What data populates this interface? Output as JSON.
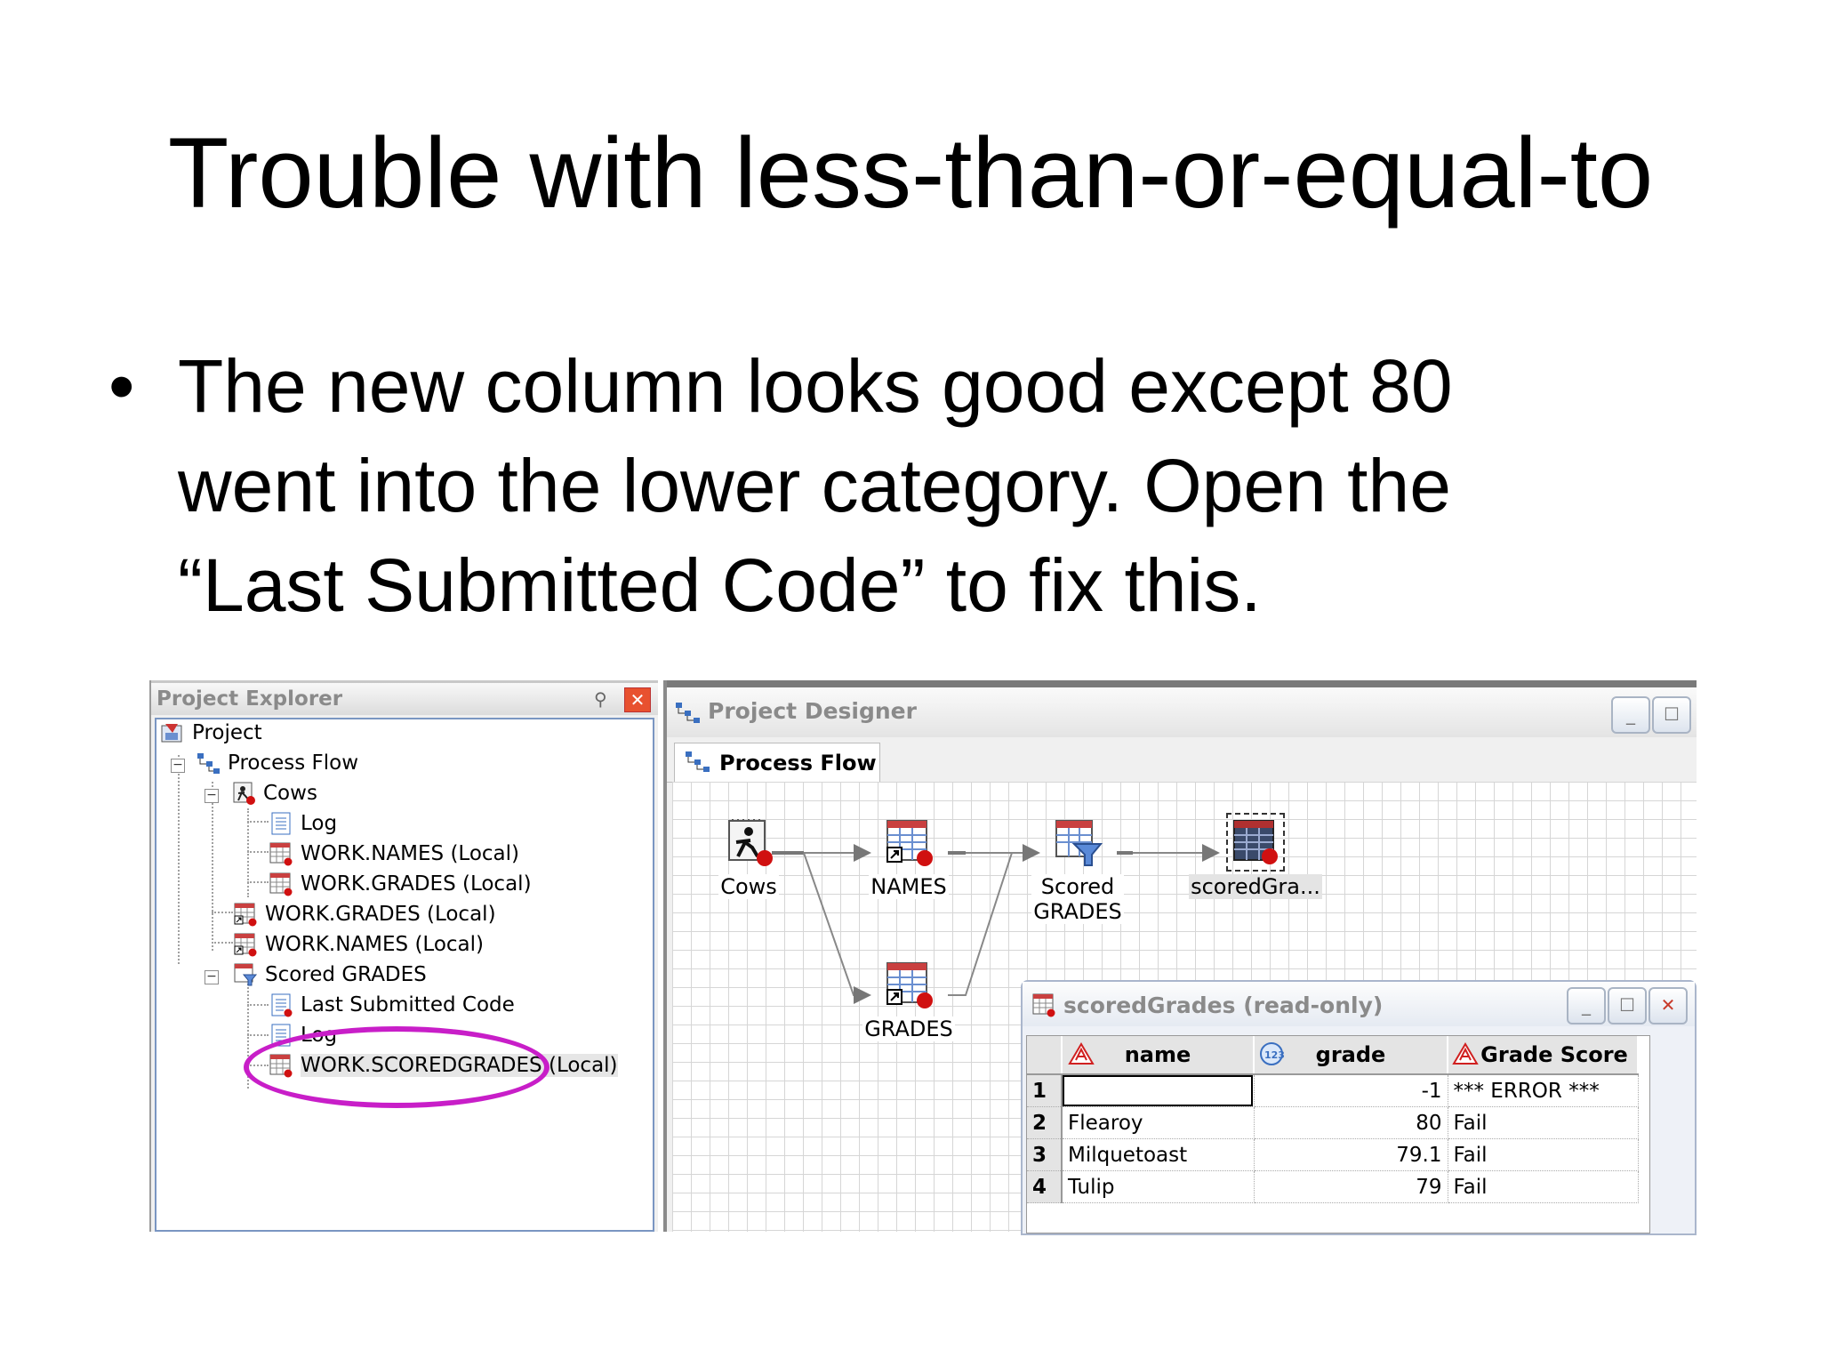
{
  "slide": {
    "title": "Trouble with less-than-or-equal-to",
    "bullet_lines": [
      "The new column looks good except 80",
      "went into the lower category.  Open the",
      "“Last Submitted Code” to fix this."
    ]
  },
  "explorer": {
    "title": "Project Explorer",
    "tree": {
      "project": "Project",
      "process_flow": "Process Flow",
      "cows": "Cows",
      "log1": "Log",
      "work_names_local_1": "WORK.NAMES (Local)",
      "work_grades_local_1": "WORK.GRADES (Local)",
      "work_grades_local_2": "WORK.GRADES (Local)",
      "work_names_local_2": "WORK.NAMES (Local)",
      "scored_grades": "Scored GRADES",
      "last_submitted_code": "Last Submitted Code",
      "log2": "Log",
      "work_scoredgrades": "WORK.SCOREDGRADES (Local)"
    }
  },
  "designer": {
    "title": "Project Designer",
    "tab": "Process Flow",
    "nodes": {
      "cows": "Cows",
      "names": "NAMES",
      "scored_line1": "Scored",
      "scored_line2": "GRADES",
      "scoredgrades": "scoredGra...",
      "grades": "GRADES"
    }
  },
  "result_window": {
    "title": "scoredGrades (read-only)",
    "columns": [
      "name",
      "grade",
      "Grade Score"
    ],
    "rows": [
      {
        "n": "1",
        "name": "",
        "grade": "-1",
        "score": "*** ERROR ***"
      },
      {
        "n": "2",
        "name": "Flearoy",
        "grade": "80",
        "score": "Fail"
      },
      {
        "n": "3",
        "name": "Milquetoast",
        "grade": "79.1",
        "score": "Fail"
      },
      {
        "n": "4",
        "name": "Tulip",
        "grade": "79",
        "score": "Fail"
      }
    ]
  },
  "colors": {
    "highlight": "#c81ec8",
    "close_red": "#e8512f",
    "accent_blue": "#7a96c2"
  }
}
